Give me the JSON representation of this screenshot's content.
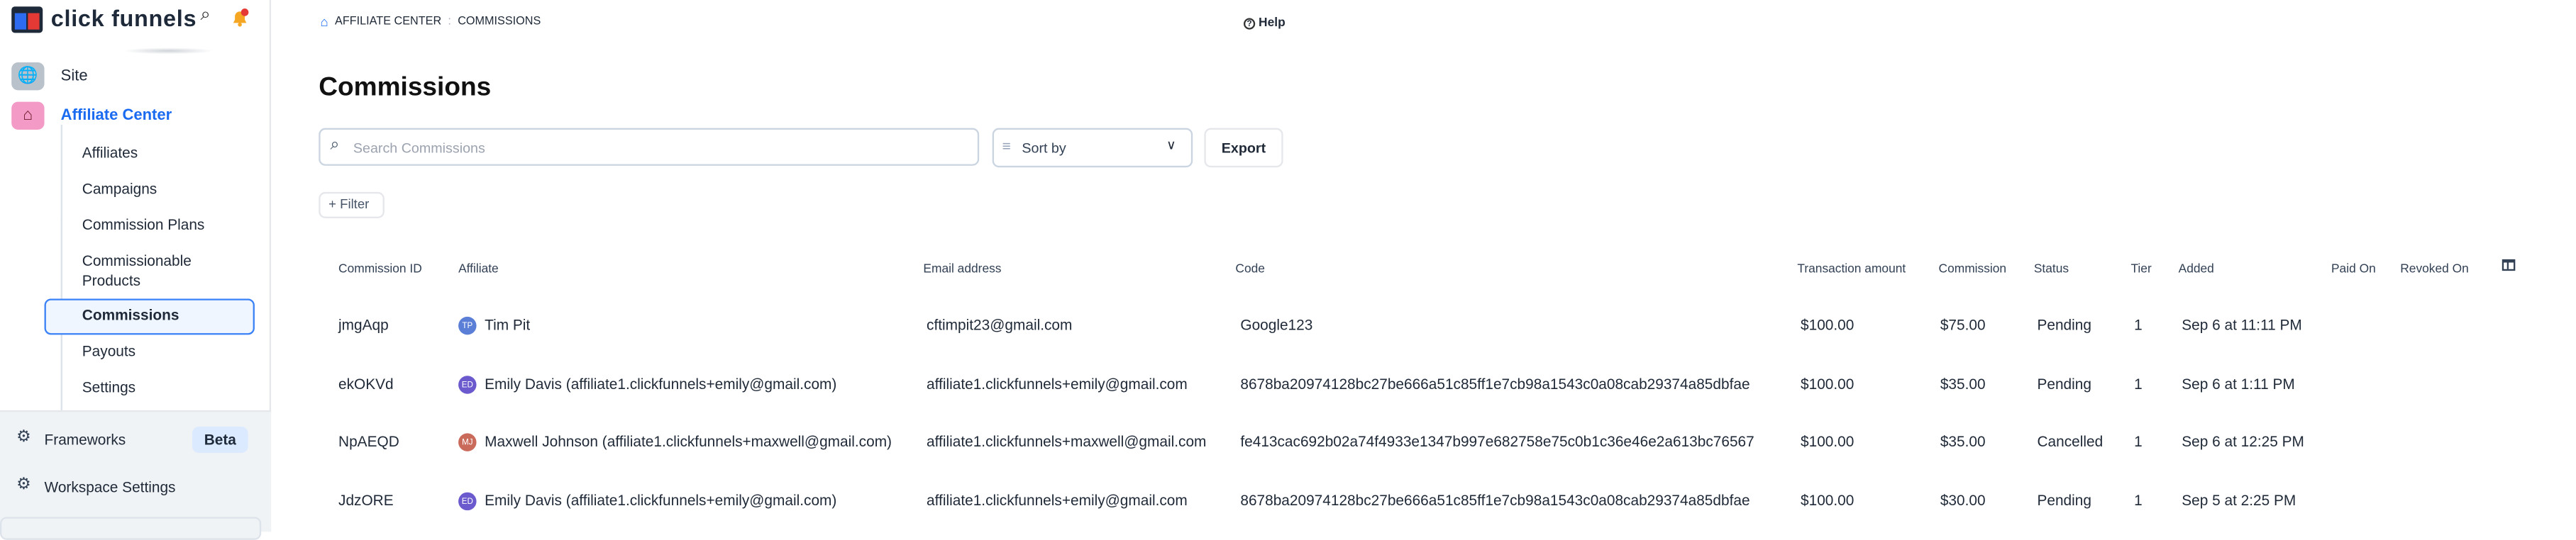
{
  "sidebar": {
    "brand": "click funnels",
    "nav": [
      {
        "label": "Site",
        "icon": "globe-icon"
      },
      {
        "label": "Affiliate Center",
        "icon": "affiliates-icon",
        "active": true
      }
    ],
    "sub_items": [
      {
        "label": "Affiliates"
      },
      {
        "label": "Campaigns"
      },
      {
        "label": "Commission Plans"
      },
      {
        "label": "Commissionable Products"
      },
      {
        "label": "Commissions",
        "active": true
      },
      {
        "label": "Payouts"
      },
      {
        "label": "Settings"
      }
    ],
    "frameworks": "Frameworks",
    "beta": "Beta",
    "workspace_settings": "Workspace Settings"
  },
  "breadcrumb": {
    "parent": "AFFILIATE CENTER",
    "separator": ":",
    "current": "COMMISSIONS"
  },
  "help": "Help",
  "page_title": "Commissions",
  "search": {
    "placeholder": "Search Commissions",
    "value": ""
  },
  "sort": {
    "label": "Sort by"
  },
  "export_label": "Export",
  "filter_label": "Filter",
  "colors": {
    "accent": "#1a6bf0",
    "active_bg": "#eff6ff"
  },
  "table": {
    "headers": [
      "Commission ID",
      "Affiliate",
      "Email address",
      "Code",
      "Transaction amount",
      "Commission",
      "Status",
      "Tier",
      "Added",
      "Paid On",
      "Revoked On"
    ],
    "rows": [
      {
        "id": "jmgAqp",
        "initials": "TP",
        "avatar_color": "#5b7fd6",
        "affiliate": "Tim Pit",
        "email": "cftimpit23@gmail.com",
        "code": "Google123",
        "amount": "$100.00",
        "commission": "$75.00",
        "status": "Pending",
        "tier": "1",
        "added": "Sep 6 at 11:11 PM",
        "paid_on": "",
        "revoked_on": ""
      },
      {
        "id": "ekOKVd",
        "initials": "ED",
        "avatar_color": "#6a5acd",
        "affiliate": "Emily Davis (affiliate1.clickfunnels+emily@gmail.com)",
        "email": "affiliate1.clickfunnels+emily@gmail.com",
        "code": "8678ba20974128bc27be666a51c85ff1e7cb98a1543c0a08cab29374a85dbfae",
        "amount": "$100.00",
        "commission": "$35.00",
        "status": "Pending",
        "tier": "1",
        "added": "Sep 6 at 1:11 PM",
        "paid_on": "",
        "revoked_on": ""
      },
      {
        "id": "NpAEQD",
        "initials": "MJ",
        "avatar_color": "#c96a5a",
        "affiliate": "Maxwell Johnson (affiliate1.clickfunnels+maxwell@gmail.com)",
        "email": "affiliate1.clickfunnels+maxwell@gmail.com",
        "code": "fe413cac692b02a74f4933e1347b997e682758e75c0b1c36e46e2a613bc76567",
        "amount": "$100.00",
        "commission": "$35.00",
        "status": "Cancelled",
        "tier": "1",
        "added": "Sep 6 at 12:25 PM",
        "paid_on": "",
        "revoked_on": ""
      },
      {
        "id": "JdzORE",
        "initials": "ED",
        "avatar_color": "#6a5acd",
        "affiliate": "Emily Davis (affiliate1.clickfunnels+emily@gmail.com)",
        "email": "affiliate1.clickfunnels+emily@gmail.com",
        "code": "8678ba20974128bc27be666a51c85ff1e7cb98a1543c0a08cab29374a85dbfae",
        "amount": "$100.00",
        "commission": "$30.00",
        "status": "Pending",
        "tier": "1",
        "added": "Sep 5 at 2:25 PM",
        "paid_on": "",
        "revoked_on": ""
      }
    ]
  }
}
